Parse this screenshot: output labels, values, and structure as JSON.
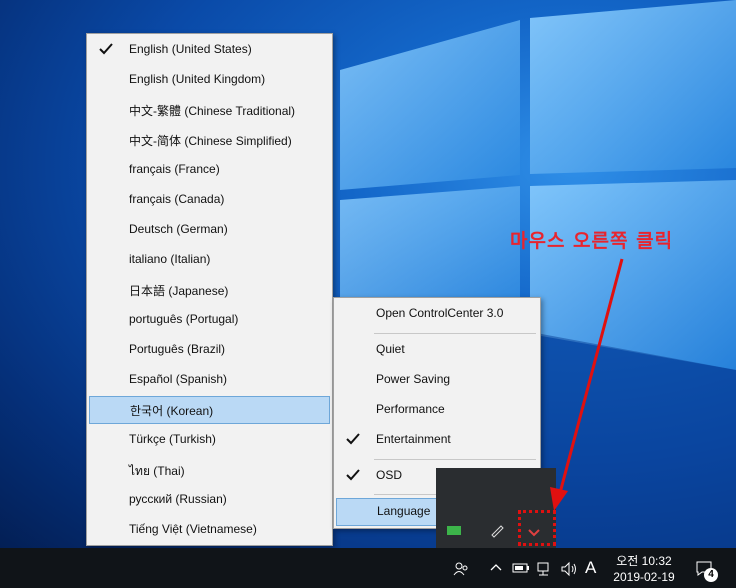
{
  "language_menu": {
    "items": [
      {
        "label": "English (United States)",
        "checked": true
      },
      {
        "label": "English (United Kingdom)"
      },
      {
        "label": "中文-繁體 (Chinese Traditional)"
      },
      {
        "label": "中文-简体 (Chinese Simplified)"
      },
      {
        "label": "français (France)"
      },
      {
        "label": "français (Canada)"
      },
      {
        "label": "Deutsch (German)"
      },
      {
        "label": "italiano (Italian)"
      },
      {
        "label": "日本語 (Japanese)"
      },
      {
        "label": "português (Portugal)"
      },
      {
        "label": "Português (Brazil)"
      },
      {
        "label": "Español (Spanish)"
      },
      {
        "label": "한국어 (Korean)",
        "highlighted": true
      },
      {
        "label": "Türkçe (Turkish)"
      },
      {
        "label": "ไทย (Thai)"
      },
      {
        "label": "русский (Russian)"
      },
      {
        "label": "Tiếng Việt (Vietnamese)"
      }
    ]
  },
  "context_menu": {
    "open": "Open ControlCenter 3.0",
    "quiet": "Quiet",
    "power_saving": "Power Saving",
    "performance": "Performance",
    "entertainment": "Entertainment",
    "osd": "OSD",
    "language": "Language"
  },
  "annotation": "마우스 오른쪽 클릭",
  "taskbar": {
    "clock_line1": "오전 10:32",
    "clock_line2": "2019-02-19",
    "ime": "A",
    "notification_count": "4"
  },
  "colors": {
    "highlight": "#bad9f5",
    "annotation": "#e8242e"
  }
}
